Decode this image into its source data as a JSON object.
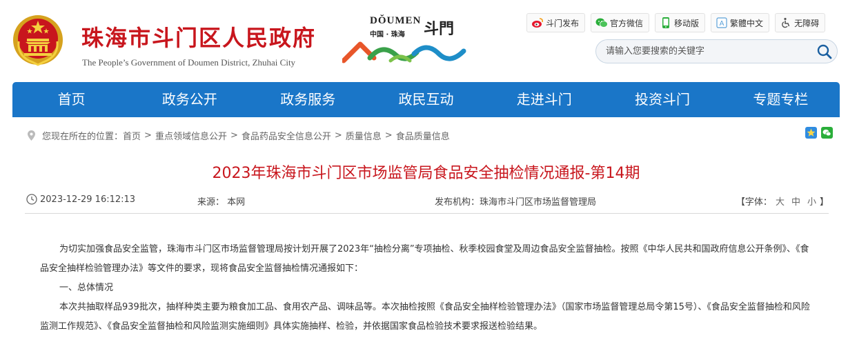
{
  "header": {
    "title": "珠海市斗门区人民政府",
    "subtitle": "The People’s Government of Doumen District, Zhuhai City",
    "doumen_en": "DŎUMEN",
    "doumen_cn": "中国 · 珠海",
    "doumen_brush": "斗門"
  },
  "toplinks": [
    {
      "label": "斗门发布",
      "icon": "weibo-icon"
    },
    {
      "label": "官方微信",
      "icon": "wechat-icon"
    },
    {
      "label": "移动版",
      "icon": "mobile-icon"
    },
    {
      "label": "繁體中文",
      "icon": "traditional-chinese-icon"
    },
    {
      "label": "无障碍",
      "icon": "accessibility-icon"
    }
  ],
  "search": {
    "placeholder": "请输入您要搜索的关键字"
  },
  "nav": [
    "首页",
    "政务公开",
    "政务服务",
    "政民互动",
    "走进斗门",
    "投资斗门",
    "专题专栏"
  ],
  "breadcrumb": {
    "prefix": "您现在所在的位置：",
    "items": [
      "首页",
      "重点领域信息公开",
      "食品药品安全信息公开",
      "质量信息",
      "食品质量信息"
    ]
  },
  "article": {
    "title": "2023年珠海市斗门区市场监管局食品安全抽检情况通报-第14期",
    "date": "2023-12-29 16:12:13",
    "source": "来源：  本网",
    "publisher": "发布机构：珠海市斗门区市场监督管理局",
    "font_label": "【字体：",
    "font_large": "大",
    "font_medium": "中",
    "font_small": "小",
    "font_end": "】",
    "paragraphs": [
      "为切实加强食品安全监管，珠海市斗门区市场监督管理局按计划开展了2023年“抽检分离”专项抽检、秋季校园食堂及周边食品安全监督抽检。按照《中华人民共和国政府信息公开条例》、《食品安全抽样检验管理办法》等文件的要求，现将食品安全监督抽检情况通报如下：",
      "一、总体情况",
      "本次共抽取样品939批次，抽样种类主要为粮食加工品、食用农产品、调味品等。本次抽检按照《食品安全抽样检验管理办法》（国家市场监督管理总局令第15号）、《食品安全监督抽检和风险监测工作规范》、《食品安全监督抽检和风险监测实施细则》具体实施抽样、检验，并依据国家食品检验技术要求报送检验结果。"
    ]
  },
  "colors": {
    "brand_red": "#c8161d",
    "nav_blue": "#1a76c8"
  }
}
